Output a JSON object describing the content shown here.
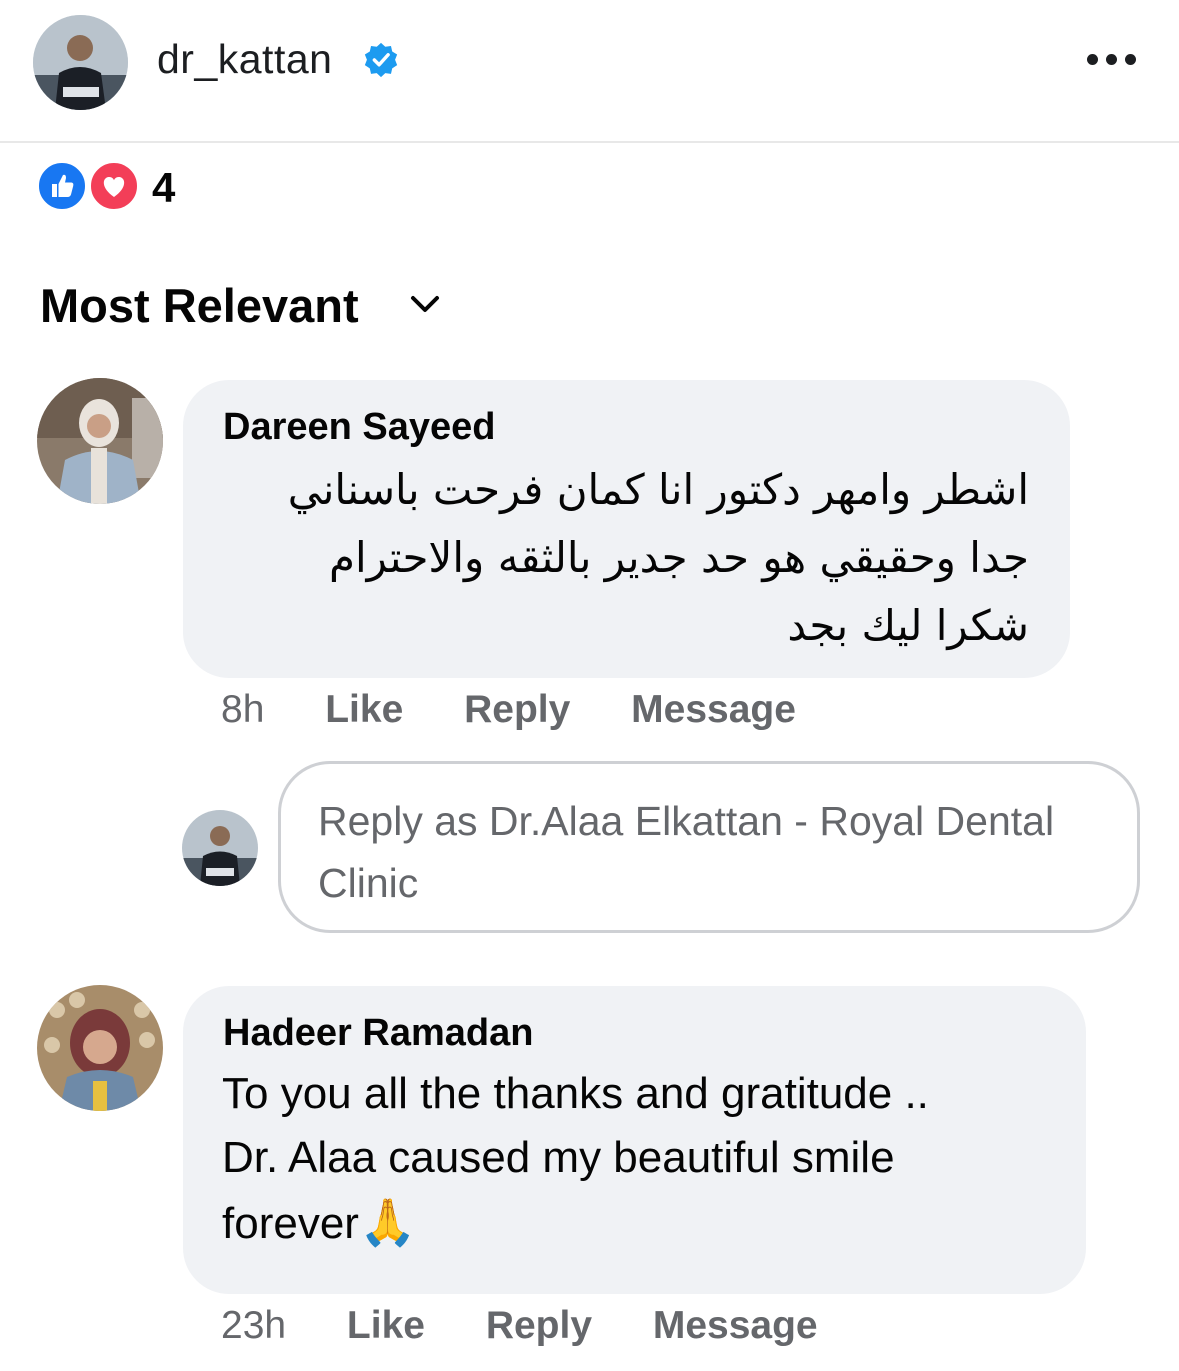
{
  "header": {
    "username": "dr_kattan",
    "verified_icon": "verified-badge-icon",
    "more_icon": "more-options-icon"
  },
  "reactions": {
    "types": [
      "like",
      "love"
    ],
    "count": "4"
  },
  "sort": {
    "label": "Most Relevant",
    "icon": "chevron-down-icon"
  },
  "comments": [
    {
      "author": "Dareen Sayeed",
      "text": "اشطر وامهر دكتور انا كمان فرحت باسناني\nجدا وحقيقي هو حد جدير بالثقه والاحترام\nشكرا ليك بجد",
      "time": "8h",
      "like_label": "Like",
      "reply_label": "Reply",
      "message_label": "Message"
    },
    {
      "author": "Hadeer Ramadan",
      "text": "To you all the thanks and gratitude ..\nDr. Alaa caused my beautiful smile\nforever",
      "emoji": "🙏",
      "time": "23h",
      "like_label": "Like",
      "reply_label": "Reply",
      "message_label": "Message"
    }
  ],
  "reply_input": {
    "placeholder": "Reply as Dr.Alaa Elkattan - Royal Dental Clinic"
  },
  "colors": {
    "like_blue": "#1877f2",
    "love_red": "#f33e58",
    "verified_blue": "#1d9bf0",
    "bubble_bg": "#f0f2f5",
    "secondary_text": "#65676b"
  }
}
